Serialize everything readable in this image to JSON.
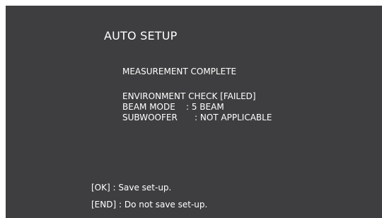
{
  "title": "AUTO SETUP",
  "status": "MEASUREMENT COMPLETE",
  "environment_check": "ENVIRONMENT CHECK [FAILED]",
  "beam_mode": {
    "label": "BEAM MODE",
    "value": ": 5 BEAM"
  },
  "subwoofer": {
    "label": "SUBWOOFER",
    "value": ": NOT APPLICABLE"
  },
  "options": [
    {
      "key": "[OK] :",
      "text": "Save set-up."
    },
    {
      "key": "[END] :",
      "text": "Do not save set-up."
    }
  ]
}
